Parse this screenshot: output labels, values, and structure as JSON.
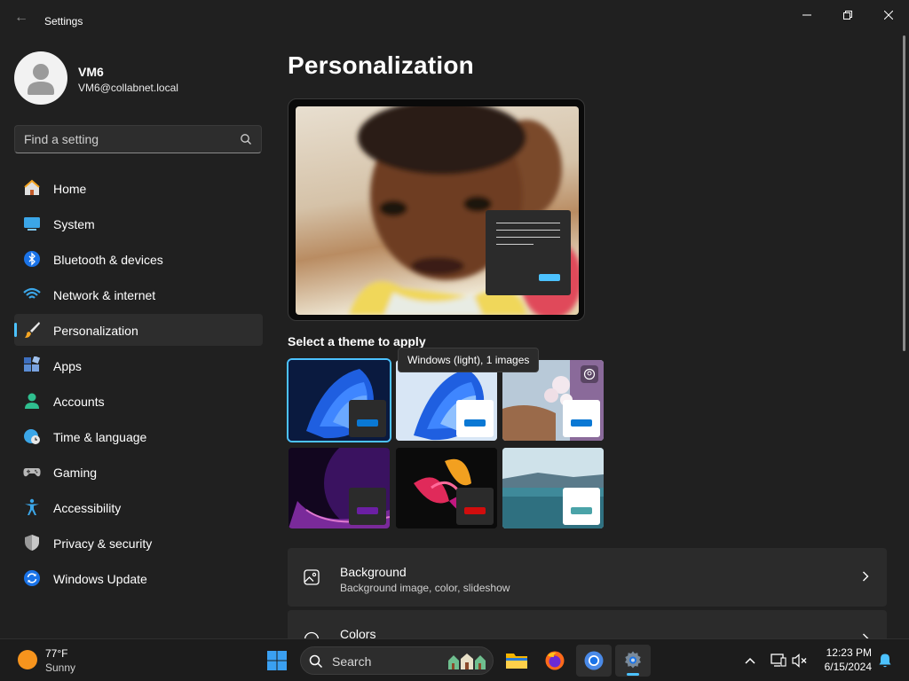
{
  "window": {
    "title": "Settings",
    "controls": [
      "minimize-icon",
      "restore-icon",
      "close-icon"
    ]
  },
  "profile": {
    "name": "VM6",
    "email": "VM6@collabnet.local"
  },
  "sidebar": {
    "search_placeholder": "Find a setting",
    "items": [
      {
        "label": "Home",
        "icon": "home-icon"
      },
      {
        "label": "System",
        "icon": "monitor-icon"
      },
      {
        "label": "Bluetooth & devices",
        "icon": "bluetooth-icon"
      },
      {
        "label": "Network & internet",
        "icon": "wifi-icon"
      },
      {
        "label": "Personalization",
        "icon": "brush-icon",
        "active": true
      },
      {
        "label": "Apps",
        "icon": "apps-icon"
      },
      {
        "label": "Accounts",
        "icon": "person-icon"
      },
      {
        "label": "Time & language",
        "icon": "globe-clock-icon"
      },
      {
        "label": "Gaming",
        "icon": "gamepad-icon"
      },
      {
        "label": "Accessibility",
        "icon": "accessibility-icon"
      },
      {
        "label": "Privacy & security",
        "icon": "shield-icon"
      },
      {
        "label": "Windows Update",
        "icon": "update-icon"
      }
    ]
  },
  "main": {
    "title": "Personalization",
    "themes_label": "Select a theme to apply",
    "tooltip": "Windows (light), 1 images",
    "themes": [
      {
        "name": "windows-dark",
        "selected": true,
        "accent": "#0a78d4"
      },
      {
        "name": "windows-light",
        "accent": "#0a78d4"
      },
      {
        "name": "flowers",
        "accent": "#0a78d4"
      },
      {
        "name": "glow",
        "accent": "#6b1fa3"
      },
      {
        "name": "captured-motion",
        "accent": "#d10d0d"
      },
      {
        "name": "sunrise",
        "accent": "#4aa3a8"
      }
    ],
    "cards": [
      {
        "title": "Background",
        "subtitle": "Background image, color, slideshow",
        "icon": "image-icon"
      },
      {
        "title": "Colors",
        "subtitle": "",
        "icon": "palette-icon"
      }
    ]
  },
  "taskbar": {
    "weather_temp": "77°F",
    "weather_cond": "Sunny",
    "search_label": "Search",
    "time": "12:23 PM",
    "date": "6/15/2024",
    "apps": [
      "file-explorer-icon",
      "firefox-icon",
      "chrome-icon",
      "settings-icon"
    ]
  },
  "colors": {
    "accent": "#4cc2ff",
    "background": "#202020",
    "card": "#2b2b2b"
  }
}
